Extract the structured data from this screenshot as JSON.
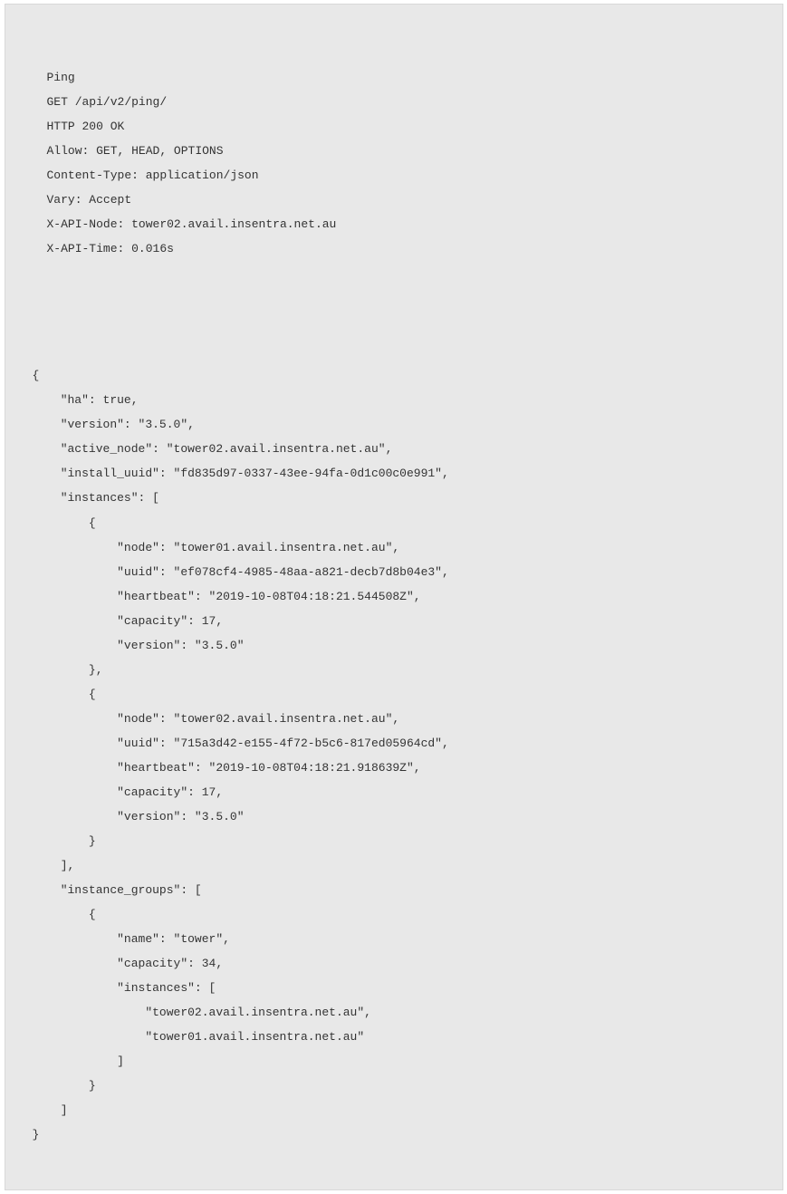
{
  "header": {
    "title": "Ping",
    "request_line": "GET /api/v2/ping/",
    "status": "HTTP 200 OK",
    "allow": "Allow: GET, HEAD, OPTIONS",
    "content_type": "Content-Type: application/json",
    "vary": "Vary: Accept",
    "api_node": "X-API-Node: tower02.avail.insentra.net.au",
    "api_time": "X-API-Time: 0.016s"
  },
  "body": {
    "l0": "{",
    "l1": "    \"ha\": true,",
    "l2": "    \"version\": \"3.5.0\",",
    "l3": "    \"active_node\": \"tower02.avail.insentra.net.au\",",
    "l4": "    \"install_uuid\": \"fd835d97-0337-43ee-94fa-0d1c00c0e991\",",
    "l5": "    \"instances\": [",
    "l6": "        {",
    "l7": "            \"node\": \"tower01.avail.insentra.net.au\",",
    "l8": "            \"uuid\": \"ef078cf4-4985-48aa-a821-decb7d8b04e3\",",
    "l9": "            \"heartbeat\": \"2019-10-08T04:18:21.544508Z\",",
    "l10": "            \"capacity\": 17,",
    "l11": "            \"version\": \"3.5.0\"",
    "l12": "        },",
    "l13": "        {",
    "l14": "            \"node\": \"tower02.avail.insentra.net.au\",",
    "l15": "            \"uuid\": \"715a3d42-e155-4f72-b5c6-817ed05964cd\",",
    "l16": "            \"heartbeat\": \"2019-10-08T04:18:21.918639Z\",",
    "l17": "            \"capacity\": 17,",
    "l18": "            \"version\": \"3.5.0\"",
    "l19": "        }",
    "l20": "    ],",
    "l21": "    \"instance_groups\": [",
    "l22": "        {",
    "l23": "            \"name\": \"tower\",",
    "l24": "            \"capacity\": 34,",
    "l25": "            \"instances\": [",
    "l26": "                \"tower02.avail.insentra.net.au\",",
    "l27": "                \"tower01.avail.insentra.net.au\"",
    "l28": "            ]",
    "l29": "        }",
    "l30": "    ]",
    "l31": "}"
  }
}
